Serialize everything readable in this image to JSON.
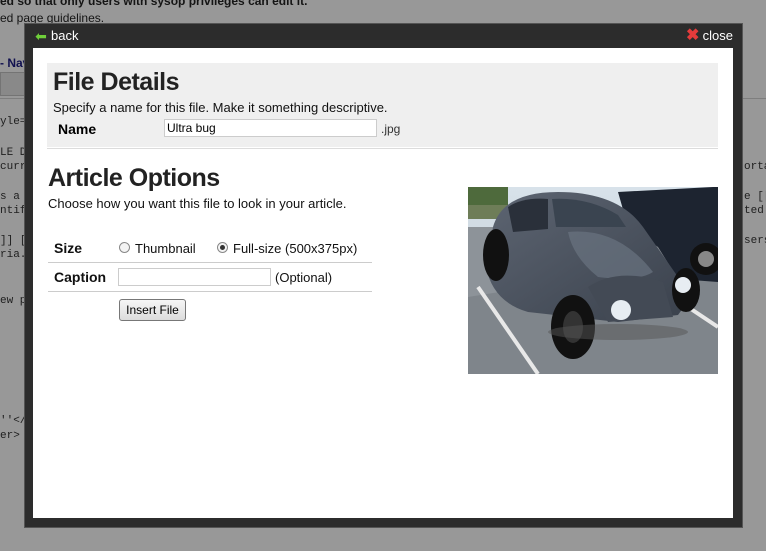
{
  "background_page": {
    "notice_line": "ed so that only users with sysop privileges can edit it.",
    "guidelines_line": "ed page guidelines.",
    "nav_line": "- Nav",
    "code_lines": [
      {
        "text": "yle=\""
      },
      {
        "text": "LE DA"
      },
      {
        "text": "curren"
      },
      {
        "text": "s a d"
      },
      {
        "text": "ntifi"
      },
      {
        "text": "]] ["
      },
      {
        "text": "ria.]"
      },
      {
        "text": "ew pa"
      },
      {
        "text": "''</t"
      },
      {
        "text": "er>"
      }
    ],
    "right_code_lines": [
      {
        "text": "ortal"
      },
      {
        "text": "e [[c"
      },
      {
        "text": "ted i"
      },
      {
        "text": "sers]"
      }
    ]
  },
  "modal": {
    "back_label": "back",
    "close_label": "close",
    "back_icon": "back-arrow-icon",
    "close_icon": "close-x-icon",
    "accent_back": "#6fcf3a",
    "accent_close": "#e53b3b"
  },
  "file_details": {
    "title": "File Details",
    "description": "Specify a name for this file. Make it something descriptive.",
    "name_label": "Name",
    "name_value": "Ultra bug",
    "extension": ".jpg"
  },
  "article_options": {
    "title": "Article Options",
    "description": "Choose how you want this file to look in your article.",
    "size_label": "Size",
    "size_options": [
      {
        "label": "Thumbnail",
        "selected": false
      },
      {
        "label": "Full-size (500x375px)",
        "selected": true
      }
    ],
    "caption_label": "Caption",
    "caption_value": "",
    "caption_hint": "(Optional)",
    "insert_button": "Insert File"
  }
}
